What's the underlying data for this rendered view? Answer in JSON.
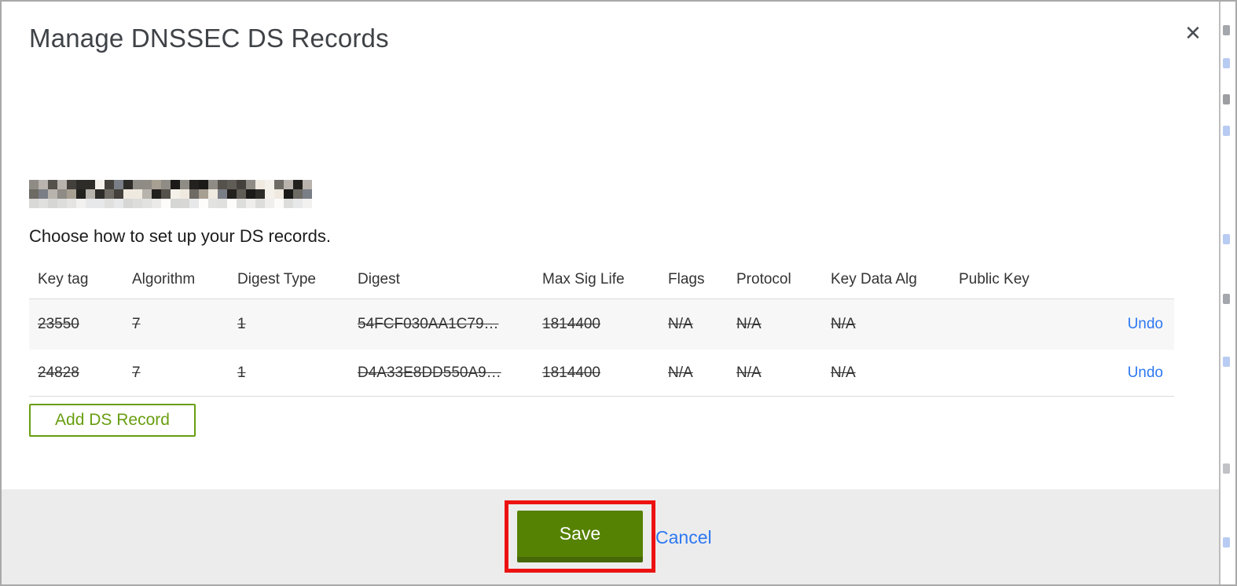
{
  "modal": {
    "title": "Manage DNSSEC DS Records",
    "close_icon": "✕",
    "instruction": "Choose how to set up your DS records.",
    "add_record_button": "Add DS Record",
    "save_button": "Save",
    "cancel_link": "Cancel"
  },
  "table": {
    "columns": [
      "Key tag",
      "Algorithm",
      "Digest Type",
      "Digest",
      "Max Sig Life",
      "Flags",
      "Protocol",
      "Key Data Alg",
      "Public Key"
    ],
    "rows": [
      {
        "cells": [
          "23550",
          "7",
          "1",
          "54FCF030AA1C79…",
          "1814400",
          "N/A",
          "N/A",
          "N/A",
          ""
        ],
        "action": "Undo",
        "struck": true
      },
      {
        "cells": [
          "24828",
          "7",
          "1",
          "D4A33E8DD550A9…",
          "1814400",
          "N/A",
          "N/A",
          "N/A",
          ""
        ],
        "action": "Undo",
        "struck": true
      }
    ]
  },
  "colors": {
    "save_green": "#568203",
    "save_green_dark": "#466809",
    "outline_green": "#699e10",
    "link_blue": "#2e78f2",
    "annotation_red": "#ed1212",
    "footer_gray": "#ececec",
    "row_stripe": "#f7f7f7"
  }
}
